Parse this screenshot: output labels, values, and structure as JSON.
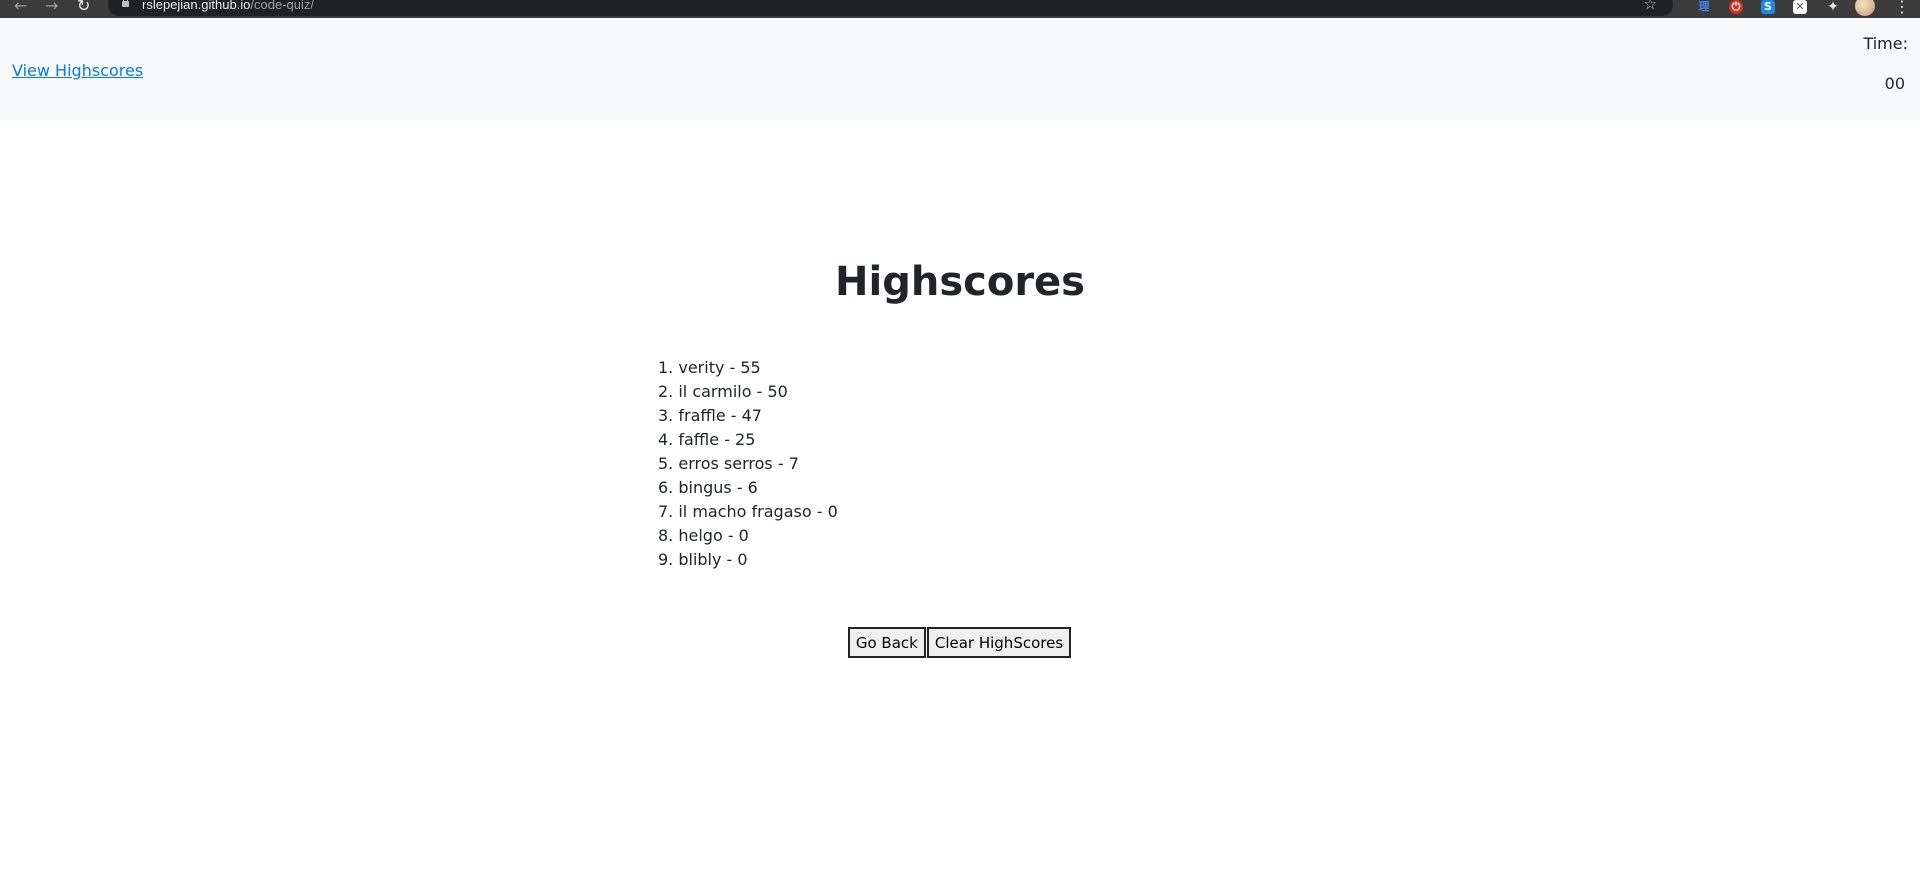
{
  "browser": {
    "url_host": "rslepejian.github.io",
    "url_path": "/code-quiz/"
  },
  "header": {
    "view_highscores": "View Highscores",
    "time_label": "Time:",
    "time_value": "00"
  },
  "main": {
    "title": "Highscores",
    "scores": [
      "1. verity - 55",
      "2. il carmilo - 50",
      "3. fraffle - 47",
      "4. faffle - 25",
      "5. erros serros - 7",
      "6. bingus - 6",
      "7. il macho fragaso - 0",
      "8. helgo - 0",
      "9. blibly - 0"
    ],
    "go_back_label": "Go Back",
    "clear_label": "Clear HighScores"
  }
}
